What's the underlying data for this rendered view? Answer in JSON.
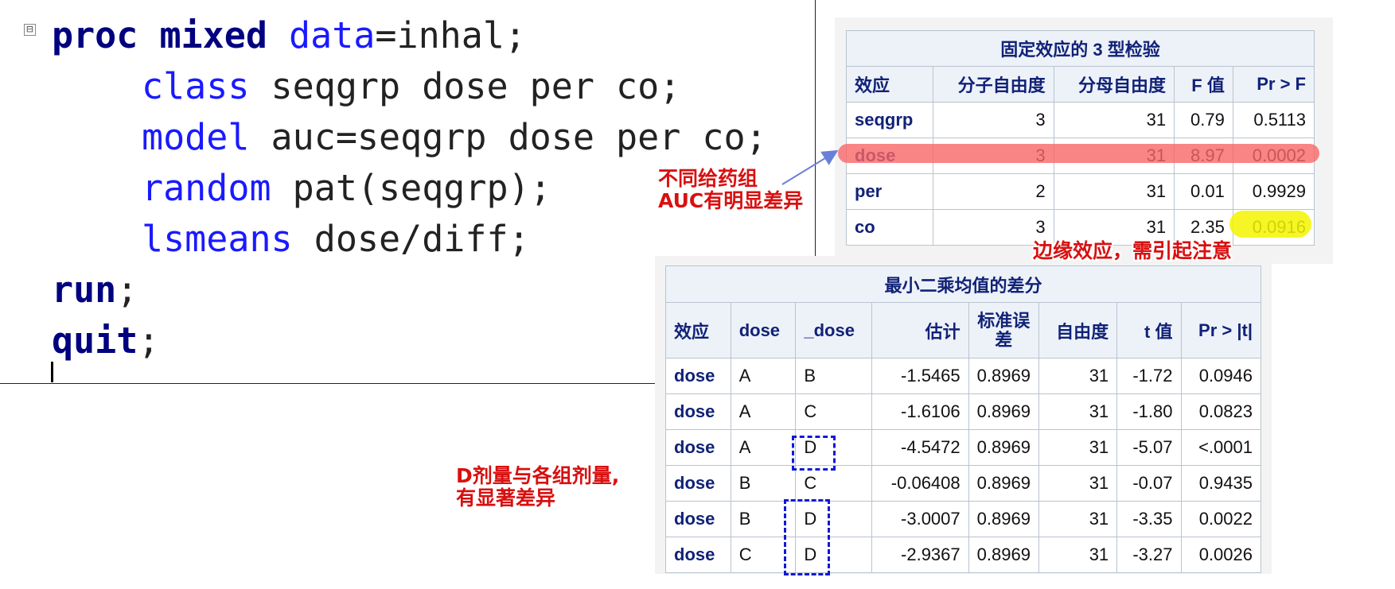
{
  "code": {
    "fold_glyph": "⊟",
    "lines": [
      [
        {
          "t": "proc mixed ",
          "c": "kw"
        },
        {
          "t": "data",
          "c": "blue"
        },
        {
          "t": "=inhal;",
          "c": ""
        }
      ],
      [
        {
          "t": "class",
          "c": "blue"
        },
        {
          "t": " seqgrp dose per co;",
          "c": ""
        }
      ],
      [
        {
          "t": "model",
          "c": "blue"
        },
        {
          "t": " auc=seqgrp dose per co;",
          "c": ""
        }
      ],
      [
        {
          "t": "random",
          "c": "blue"
        },
        {
          "t": " pat(seqgrp);",
          "c": ""
        }
      ],
      [
        {
          "t": "lsmeans",
          "c": "blue"
        },
        {
          "t": " dose/diff;",
          "c": ""
        }
      ],
      [
        {
          "t": "run",
          "c": "kw"
        },
        {
          "t": ";",
          "c": ""
        }
      ],
      [
        {
          "t": "quit",
          "c": "kw"
        },
        {
          "t": ";",
          "c": ""
        }
      ]
    ]
  },
  "type3": {
    "caption": "固定效应的 3 型检验",
    "headers": [
      "效应",
      "分子自由度",
      "分母自由度",
      "F 值",
      "Pr > F"
    ],
    "rows": [
      [
        "seqgrp",
        "3",
        "31",
        "0.79",
        "0.5113"
      ],
      [
        "dose",
        "3",
        "31",
        "8.97",
        "0.0002"
      ],
      [
        "per",
        "2",
        "31",
        "0.01",
        "0.9929"
      ],
      [
        "co",
        "3",
        "31",
        "2.35",
        "0.0916"
      ]
    ]
  },
  "lsdiff": {
    "caption": "最小二乘均值的差分",
    "headers": [
      "效应",
      "dose",
      "_dose",
      "估计",
      "标准误差",
      "自由度",
      "t 值",
      "Pr > |t|"
    ],
    "rows": [
      [
        "dose",
        "A",
        "B",
        "-1.5465",
        "0.8969",
        "31",
        "-1.72",
        "0.0946"
      ],
      [
        "dose",
        "A",
        "C",
        "-1.6106",
        "0.8969",
        "31",
        "-1.80",
        "0.0823"
      ],
      [
        "dose",
        "A",
        "D",
        "-4.5472",
        "0.8969",
        "31",
        "-5.07",
        "<.0001"
      ],
      [
        "dose",
        "B",
        "C",
        "-0.06408",
        "0.8969",
        "31",
        "-0.07",
        "0.9435"
      ],
      [
        "dose",
        "B",
        "D",
        "-3.0007",
        "0.8969",
        "31",
        "-3.35",
        "0.0022"
      ],
      [
        "dose",
        "C",
        "D",
        "-2.9367",
        "0.8969",
        "31",
        "-3.27",
        "0.0026"
      ]
    ]
  },
  "annotations": {
    "note1_line1": "不同给药组",
    "note1_line2": "AUC有明显差异",
    "note2": "边缘效应，需引起注意",
    "note3_line1": "D剂量与各组剂量,",
    "note3_line2": "有显著差异",
    "highlight_red_color": "#f86767",
    "highlight_yellow_color": "#f5f500",
    "box_color": "#1018d8"
  }
}
